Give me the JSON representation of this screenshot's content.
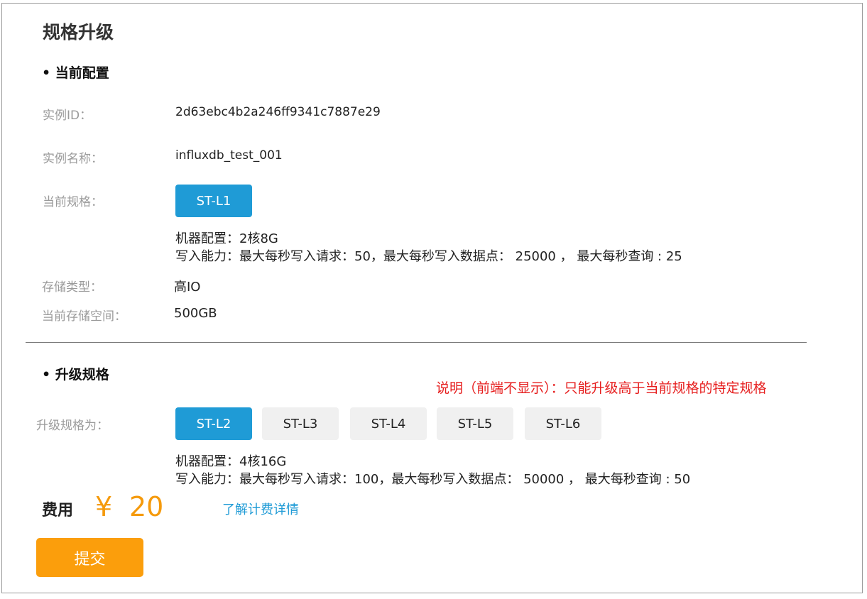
{
  "page": {
    "title": "规格升级"
  },
  "current": {
    "heading": "• 当前配置",
    "instance_id_label": "实例ID：",
    "instance_id": "2d63ebc4b2a246ff9341c7887e29",
    "instance_name_label": "实例名称：",
    "instance_name": "influxdb_test_001",
    "spec_label": "当前规格：",
    "spec": "ST-L1",
    "machine_config": "机器配置：2核8G",
    "write_capacity": "写入能力：最大每秒写入请求：50，最大每秒写入数据点： 25000 ， 最大每秒查询 : 25",
    "storage_type_label": "存储类型：",
    "storage_type": "高IO",
    "storage_space_label": "当前存储空间：",
    "storage_space": "500GB"
  },
  "upgrade": {
    "heading": "• 升级规格",
    "note": "说明（前端不显示）：只能升级高于当前规格的特定规格",
    "spec_label": "升级规格为：",
    "options": [
      "ST-L2",
      "ST-L3",
      "ST-L4",
      "ST-L5",
      "ST-L6"
    ],
    "selected": "ST-L2",
    "machine_config": "机器配置：4核16G",
    "write_capacity": "写入能力：最大每秒写入请求：100，最大每秒写入数据点： 50000 ， 最大每秒查询 : 50"
  },
  "fee": {
    "label": "费用",
    "currency": "¥",
    "amount": "20",
    "details_link": "了解计费详情"
  },
  "submit_label": "提交",
  "colors": {
    "accent_blue": "#1f9bd6",
    "price_orange": "#f59a0c",
    "submit_orange": "#fb9e0c",
    "note_red": "#e61e1e"
  }
}
